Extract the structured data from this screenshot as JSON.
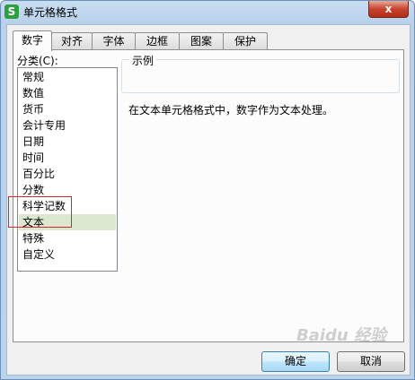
{
  "window": {
    "title": "单元格格式",
    "app_icon": "S",
    "close_symbol": "x"
  },
  "tabs": [
    {
      "label": "数字",
      "active": true
    },
    {
      "label": "对齐",
      "active": false
    },
    {
      "label": "字体",
      "active": false
    },
    {
      "label": "边框",
      "active": false
    },
    {
      "label": "图案",
      "active": false
    },
    {
      "label": "保护",
      "active": false
    }
  ],
  "category": {
    "label": "分类(C):",
    "items": [
      "常规",
      "数值",
      "货币",
      "会计专用",
      "日期",
      "时间",
      "百分比",
      "分数",
      "科学记数",
      "文本",
      "特殊",
      "自定义"
    ],
    "selected": "文本"
  },
  "sample": {
    "label": "示例",
    "value": ""
  },
  "description": "在文本单元格格式中，数字作为文本处理。",
  "buttons": {
    "ok": "确定",
    "cancel": "取消"
  },
  "watermark": "Baidu 经验",
  "colors": {
    "selection": "#dbe8cf",
    "highlight_box": "#d9262e",
    "titlebar": "#c9ddf2"
  }
}
